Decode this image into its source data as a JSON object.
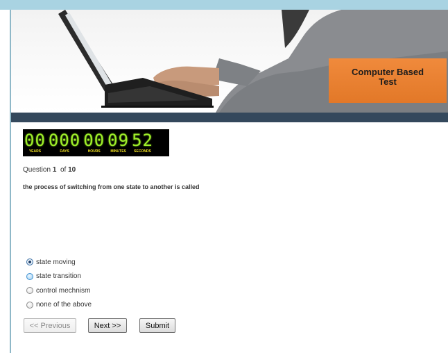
{
  "banner": {
    "label_line1": "Computer Based",
    "label_line2": "Test"
  },
  "timer": {
    "segments": [
      {
        "value": "00",
        "label": "YEARS"
      },
      {
        "value": "000",
        "label": "DAYS"
      },
      {
        "value": "00",
        "label": "HOURS"
      },
      {
        "value": "09",
        "label": "MINUTES"
      },
      {
        "value": "52",
        "label": "SECONDS"
      }
    ]
  },
  "question": {
    "prefix": "Question",
    "number": "1",
    "of_text": "of",
    "total": "10",
    "text": "the process of switching from one state to another is called"
  },
  "options": [
    {
      "label": "state moving",
      "state": "checked"
    },
    {
      "label": "state transition",
      "state": "hover"
    },
    {
      "label": "control mechnism",
      "state": "unchecked"
    },
    {
      "label": "none of the above",
      "state": "unchecked"
    }
  ],
  "buttons": {
    "previous": "<< Previous",
    "next": "Next >>",
    "submit": "Submit"
  },
  "colors": {
    "timer_digits": "#9fef2b",
    "timer_labels": "#f0e020",
    "banner_accent": "#e27828",
    "dark_band": "#34485c"
  }
}
